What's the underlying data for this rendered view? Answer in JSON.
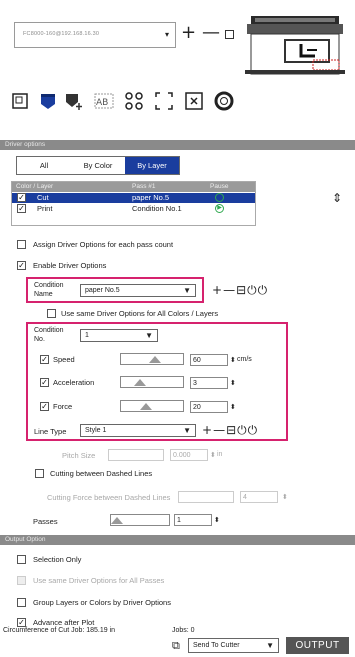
{
  "device": {
    "label": "FC8000-160@192.168.16.30"
  },
  "driver_options": {
    "header": "Driver options",
    "tabs": [
      "All",
      "By Color",
      "By Layer"
    ],
    "active_tab": "By Layer",
    "table": {
      "headers": [
        "Color / Layer",
        "Pass #1",
        "Pause"
      ],
      "rows": [
        {
          "checked": true,
          "name": "Cut",
          "pass": "paper No.5",
          "selected": true
        },
        {
          "checked": true,
          "name": "Print",
          "pass": "Condition No.1",
          "selected": false
        }
      ]
    },
    "assign_label": "Assign Driver Options for each pass count",
    "enable_label": "Enable Driver Options",
    "condition_name_label": "Condition Name",
    "condition_name_value": "paper No.5",
    "same_options_label": "Use same Driver Options for All Colors / Layers",
    "condition_no_label": "Condition No.",
    "condition_no_value": "1",
    "speed": {
      "label": "Speed",
      "value": "60",
      "unit": "cm/s",
      "level": 0.55
    },
    "acceleration": {
      "label": "Acceleration",
      "value": "3",
      "level": 0.3
    },
    "force": {
      "label": "Force",
      "value": "20",
      "level": 0.4
    },
    "line_type_label": "Line Type",
    "line_type_value": "Style 1",
    "pitch_label": "Pitch Size",
    "pitch_value": "0.000",
    "pitch_unit": "in",
    "dashed_label": "Cutting between Dashed Lines",
    "dashed_force_label": "Cutting Force between Dashed Lines",
    "dashed_force_value": "4",
    "passes_label": "Passes",
    "passes_value": "1"
  },
  "output_option": {
    "header": "Output Option",
    "selection_only": "Selection Only",
    "use_same": "Use same Driver Options for All Passes",
    "group_layers": "Group Layers or Colors by Driver Options",
    "advance": "Advance after Plot"
  },
  "footer": {
    "circumference": "Circumference of Cut Job: 185.19 in",
    "jobs": "Jobs: 0",
    "destination": "Send To Cutter",
    "output_button": "OUTPUT"
  },
  "colors": {
    "accent": "#1a3d9e",
    "highlight": "#d6226e",
    "section": "#8a8a8a"
  }
}
